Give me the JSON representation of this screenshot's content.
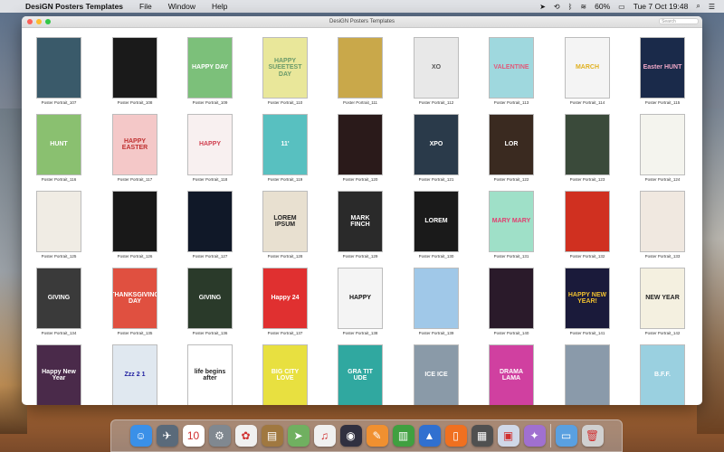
{
  "menubar": {
    "app_name": "DesiGN Posters Templates",
    "items": [
      "File",
      "Window",
      "Help"
    ],
    "battery": "60%",
    "clock": "Tue 7 Oct  19:48"
  },
  "window": {
    "title": "DesiGN Posters Templates",
    "search_placeholder": "Search"
  },
  "posters": [
    {
      "label": "Poster Portrait_107",
      "bg": "#3a5a6a",
      "fg": "#fff",
      "text": ""
    },
    {
      "label": "Poster Portrait_108",
      "bg": "#1a1a1a",
      "fg": "#fff",
      "text": ""
    },
    {
      "label": "Poster Portrait_109",
      "bg": "#7cc07a",
      "fg": "#fff",
      "text": "HAPPY DAY"
    },
    {
      "label": "Poster Portrait_110",
      "bg": "#e9e79a",
      "fg": "#6a9a6a",
      "text": "HAPPY SUEETEST DAY"
    },
    {
      "label": "Poster Portrait_111",
      "bg": "#c9a84a",
      "fg": "#333",
      "text": ""
    },
    {
      "label": "Poster Portrait_112",
      "bg": "#e8e8e8",
      "fg": "#555",
      "text": "XO"
    },
    {
      "label": "Poster Portrait_113",
      "bg": "#9fd8de",
      "fg": "#e05a7a",
      "text": "VALENTINE"
    },
    {
      "label": "Poster Portrait_114",
      "bg": "#f4f4f4",
      "fg": "#e0b020",
      "text": "MARCH"
    },
    {
      "label": "Poster Portrait_115",
      "bg": "#1a2a4a",
      "fg": "#f0a8c8",
      "text": "Easter HUNT"
    },
    {
      "label": "Poster Portrait_116",
      "bg": "#8ac070",
      "fg": "#fff",
      "text": "HUNT"
    },
    {
      "label": "Poster Portrait_117",
      "bg": "#f4c8c8",
      "fg": "#c03030",
      "text": "HAPPY EASTER"
    },
    {
      "label": "Poster Portrait_118",
      "bg": "#f8f0f0",
      "fg": "#d04050",
      "text": "HAPPY"
    },
    {
      "label": "Poster Portrait_119",
      "bg": "#58c0c0",
      "fg": "#fff",
      "text": "11'"
    },
    {
      "label": "Poster Portrait_120",
      "bg": "#2a1a1a",
      "fg": "#d08090",
      "text": ""
    },
    {
      "label": "Poster Portrait_121",
      "bg": "#2a3a4a",
      "fg": "#fff",
      "text": "XPO"
    },
    {
      "label": "Poster Portrait_122",
      "bg": "#3a2a20",
      "fg": "#fff",
      "text": "LOR"
    },
    {
      "label": "Poster Portrait_123",
      "bg": "#3a4a3a",
      "fg": "#fff",
      "text": ""
    },
    {
      "label": "Poster Portrait_124",
      "bg": "#f4f4ee",
      "fg": "#777",
      "text": ""
    },
    {
      "label": "Poster Portrait_125",
      "bg": "#f0ece4",
      "fg": "#a08050",
      "text": ""
    },
    {
      "label": "Poster Portrait_126",
      "bg": "#181818",
      "fg": "#fff",
      "text": ""
    },
    {
      "label": "Poster Portrait_127",
      "bg": "#101828",
      "fg": "#40a0ff",
      "text": ""
    },
    {
      "label": "Poster Portrait_128",
      "bg": "#e8e0d0",
      "fg": "#222",
      "text": "LOREM IPSUM"
    },
    {
      "label": "Poster Portrait_129",
      "bg": "#2a2a2a",
      "fg": "#fff",
      "text": "MARK FINCH"
    },
    {
      "label": "Poster Portrait_130",
      "bg": "#1a1a1a",
      "fg": "#fff",
      "text": "LOREM"
    },
    {
      "label": "Poster Portrait_131",
      "bg": "#9fe0c8",
      "fg": "#e04070",
      "text": "MARY MARY"
    },
    {
      "label": "Poster Portrait_132",
      "bg": "#d03020",
      "fg": "#f0c030",
      "text": ""
    },
    {
      "label": "Poster Portrait_133",
      "bg": "#f0e8e0",
      "fg": "#333",
      "text": ""
    },
    {
      "label": "Poster Portrait_134",
      "bg": "#3a3a3a",
      "fg": "#fff",
      "text": "GIVING"
    },
    {
      "label": "Poster Portrait_135",
      "bg": "#e05040",
      "fg": "#fff",
      "text": "THANKSGIVING DAY"
    },
    {
      "label": "Poster Portrait_136",
      "bg": "#2a3a2a",
      "fg": "#fff",
      "text": "GIVING"
    },
    {
      "label": "Poster Portrait_137",
      "bg": "#e03030",
      "fg": "#fff",
      "text": "Happy 24"
    },
    {
      "label": "Poster Portrait_138",
      "bg": "#f4f4f4",
      "fg": "#111",
      "text": "HAPPY"
    },
    {
      "label": "Poster Portrait_139",
      "bg": "#a0c8e8",
      "fg": "#e04060",
      "text": ""
    },
    {
      "label": "Poster Portrait_140",
      "bg": "#2a1a2a",
      "fg": "#e03040",
      "text": ""
    },
    {
      "label": "Poster Portrait_141",
      "bg": "#1a1a3a",
      "fg": "#f0c030",
      "text": "HAPPY NEW YEAR!"
    },
    {
      "label": "Poster Portrait_142",
      "bg": "#f4f0e0",
      "fg": "#222",
      "text": "NEW YEAR"
    },
    {
      "label": "",
      "bg": "#4a2a4a",
      "fg": "#fff",
      "text": "Happy New Year"
    },
    {
      "label": "",
      "bg": "#e0e8f0",
      "fg": "#2020a0",
      "text": "Zzz 2 1"
    },
    {
      "label": "",
      "bg": "#fff",
      "fg": "#222",
      "text": "life begins after"
    },
    {
      "label": "",
      "bg": "#e8e040",
      "fg": "#fff",
      "text": "BIG CITY LOVE"
    },
    {
      "label": "",
      "bg": "#30a8a0",
      "fg": "#fff",
      "text": "GRA TIT UDE"
    },
    {
      "label": "",
      "bg": "#8a9aa8",
      "fg": "#fff",
      "text": "ICE ICE"
    },
    {
      "label": "",
      "bg": "#d040a0",
      "fg": "#fff",
      "text": "DRAMA LAMA"
    },
    {
      "label": "",
      "bg": "#8a9aaa",
      "fg": "#fff",
      "text": ""
    },
    {
      "label": "",
      "bg": "#9ad0e0",
      "fg": "#fff",
      "text": "B.F.F."
    }
  ],
  "dock": [
    {
      "name": "finder",
      "bg": "#3a90e8",
      "glyph": "☺"
    },
    {
      "name": "launchpad",
      "bg": "#5a6a7a",
      "glyph": "✈"
    },
    {
      "name": "calendar",
      "bg": "#ffffff",
      "glyph": "10"
    },
    {
      "name": "system-preferences",
      "bg": "#808890",
      "glyph": "⚙"
    },
    {
      "name": "photos",
      "bg": "#f0f0f0",
      "glyph": "✿"
    },
    {
      "name": "notes",
      "bg": "#a07840",
      "glyph": "▤"
    },
    {
      "name": "maps",
      "bg": "#70b060",
      "glyph": "➤"
    },
    {
      "name": "music",
      "bg": "#f0f0f0",
      "glyph": "♫"
    },
    {
      "name": "siri",
      "bg": "#303040",
      "glyph": "◉"
    },
    {
      "name": "pages",
      "bg": "#f09030",
      "glyph": "✎"
    },
    {
      "name": "numbers",
      "bg": "#40a040",
      "glyph": "▥"
    },
    {
      "name": "keynote",
      "bg": "#3070d0",
      "glyph": "▲"
    },
    {
      "name": "books",
      "bg": "#f07020",
      "glyph": "▯"
    },
    {
      "name": "calculator",
      "bg": "#505050",
      "glyph": "▦"
    },
    {
      "name": "preview",
      "bg": "#d0d8e8",
      "glyph": "▣"
    },
    {
      "name": "design-app",
      "bg": "#a070d0",
      "glyph": "✦"
    },
    {
      "name": "folder",
      "bg": "#5aa0e0",
      "glyph": "▭"
    },
    {
      "name": "trash",
      "bg": "#d0d0d0",
      "glyph": "🗑"
    }
  ],
  "colors": {
    "window_bg": "#ffffff",
    "menubar_bg": "#ebebee"
  }
}
